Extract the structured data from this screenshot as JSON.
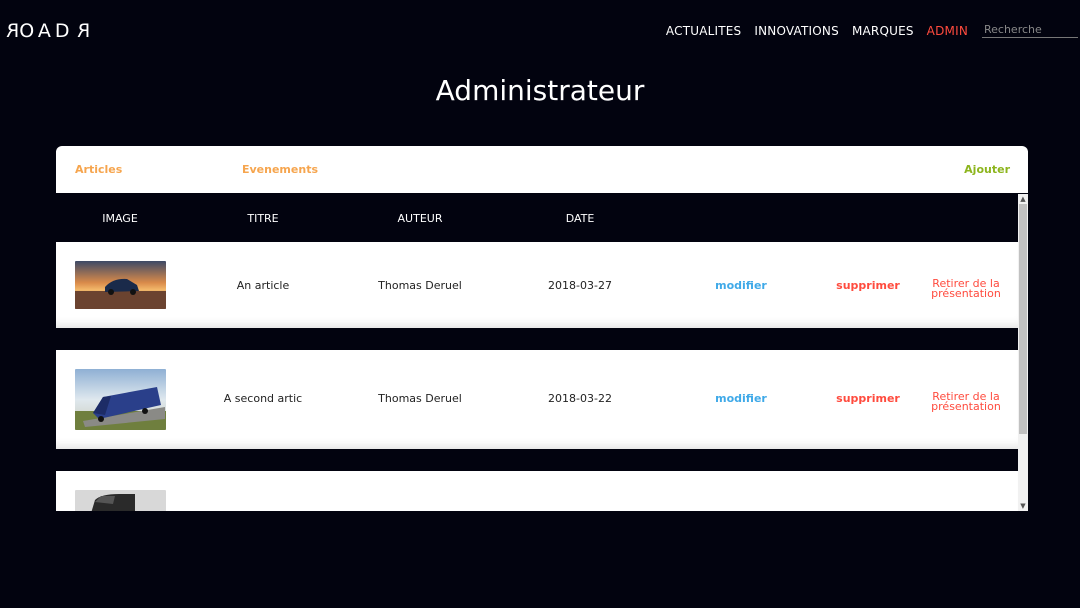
{
  "header": {
    "logo_left": "RO",
    "logo_mid": "A",
    "logo_right_D": "D",
    "logo_right_R": "R",
    "nav": {
      "actualites": "ACTUALITES",
      "innovations": "INNOVATIONS",
      "marques": "MARQUES",
      "admin": "ADMIN"
    },
    "search_placeholder": "Recherche"
  },
  "page": {
    "title": "Administrateur"
  },
  "tabs": {
    "articles": "Articles",
    "evenements": "Evenements",
    "ajouter": "Ajouter"
  },
  "table": {
    "headers": {
      "image": "IMAGE",
      "titre": "TITRE",
      "auteur": "AUTEUR",
      "date": "DATE"
    },
    "rows": [
      {
        "image": "car-sunset-thumbnail",
        "titre": "An article",
        "auteur": "Thomas Deruel",
        "date": "2018-03-27",
        "modifier": "modifier",
        "supprimer": "supprimer",
        "retirer": "Retirer de la présentation"
      },
      {
        "image": "truck-thumbnail",
        "titre": "A second artic",
        "auteur": "Thomas Deruel",
        "date": "2018-03-22",
        "modifier": "modifier",
        "supprimer": "supprimer",
        "retirer": "Retirer de la présentation"
      },
      {
        "image": "van-thumbnail"
      }
    ]
  },
  "colors": {
    "background": "#02030f",
    "accent_orange": "#f6a54e",
    "accent_green": "#8db51d",
    "admin_red": "#ff4b3e",
    "link_blue": "#3fa9e8"
  }
}
